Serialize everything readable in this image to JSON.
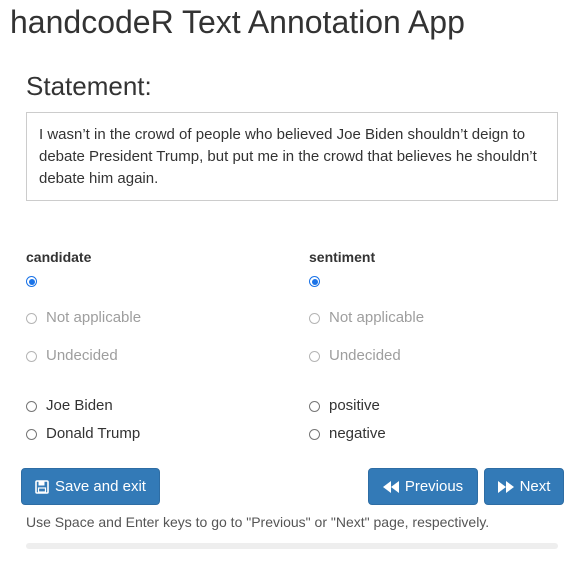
{
  "app": {
    "title": "handcodeR Text Annotation App"
  },
  "statement": {
    "heading": "Statement:",
    "text": "I wasn’t in the crowd of people who believed Joe Biden shouldn’t deign to debate President Trump, but put me in the crowd that believes he shouldn’t debate him again."
  },
  "groups": {
    "candidate": {
      "label": "candidate",
      "selected": "",
      "options": [
        "",
        "Not applicable",
        "Undecided",
        "Joe Biden",
        "Donald Trump"
      ]
    },
    "sentiment": {
      "label": "sentiment",
      "selected": "",
      "options": [
        "",
        "Not applicable",
        "Undecided",
        "positive",
        "negative"
      ]
    }
  },
  "buttons": {
    "save_label": "Save and exit",
    "prev_label": "Previous",
    "next_label": "Next"
  },
  "help_text": "Use Space and Enter keys to go to \"Previous\" or \"Next\" page, respectively.",
  "progress": {
    "value": 0
  },
  "colors": {
    "primary": "#337ab7",
    "radio_checked": "#1a73e8",
    "disabled_text": "#9e9e9e"
  }
}
